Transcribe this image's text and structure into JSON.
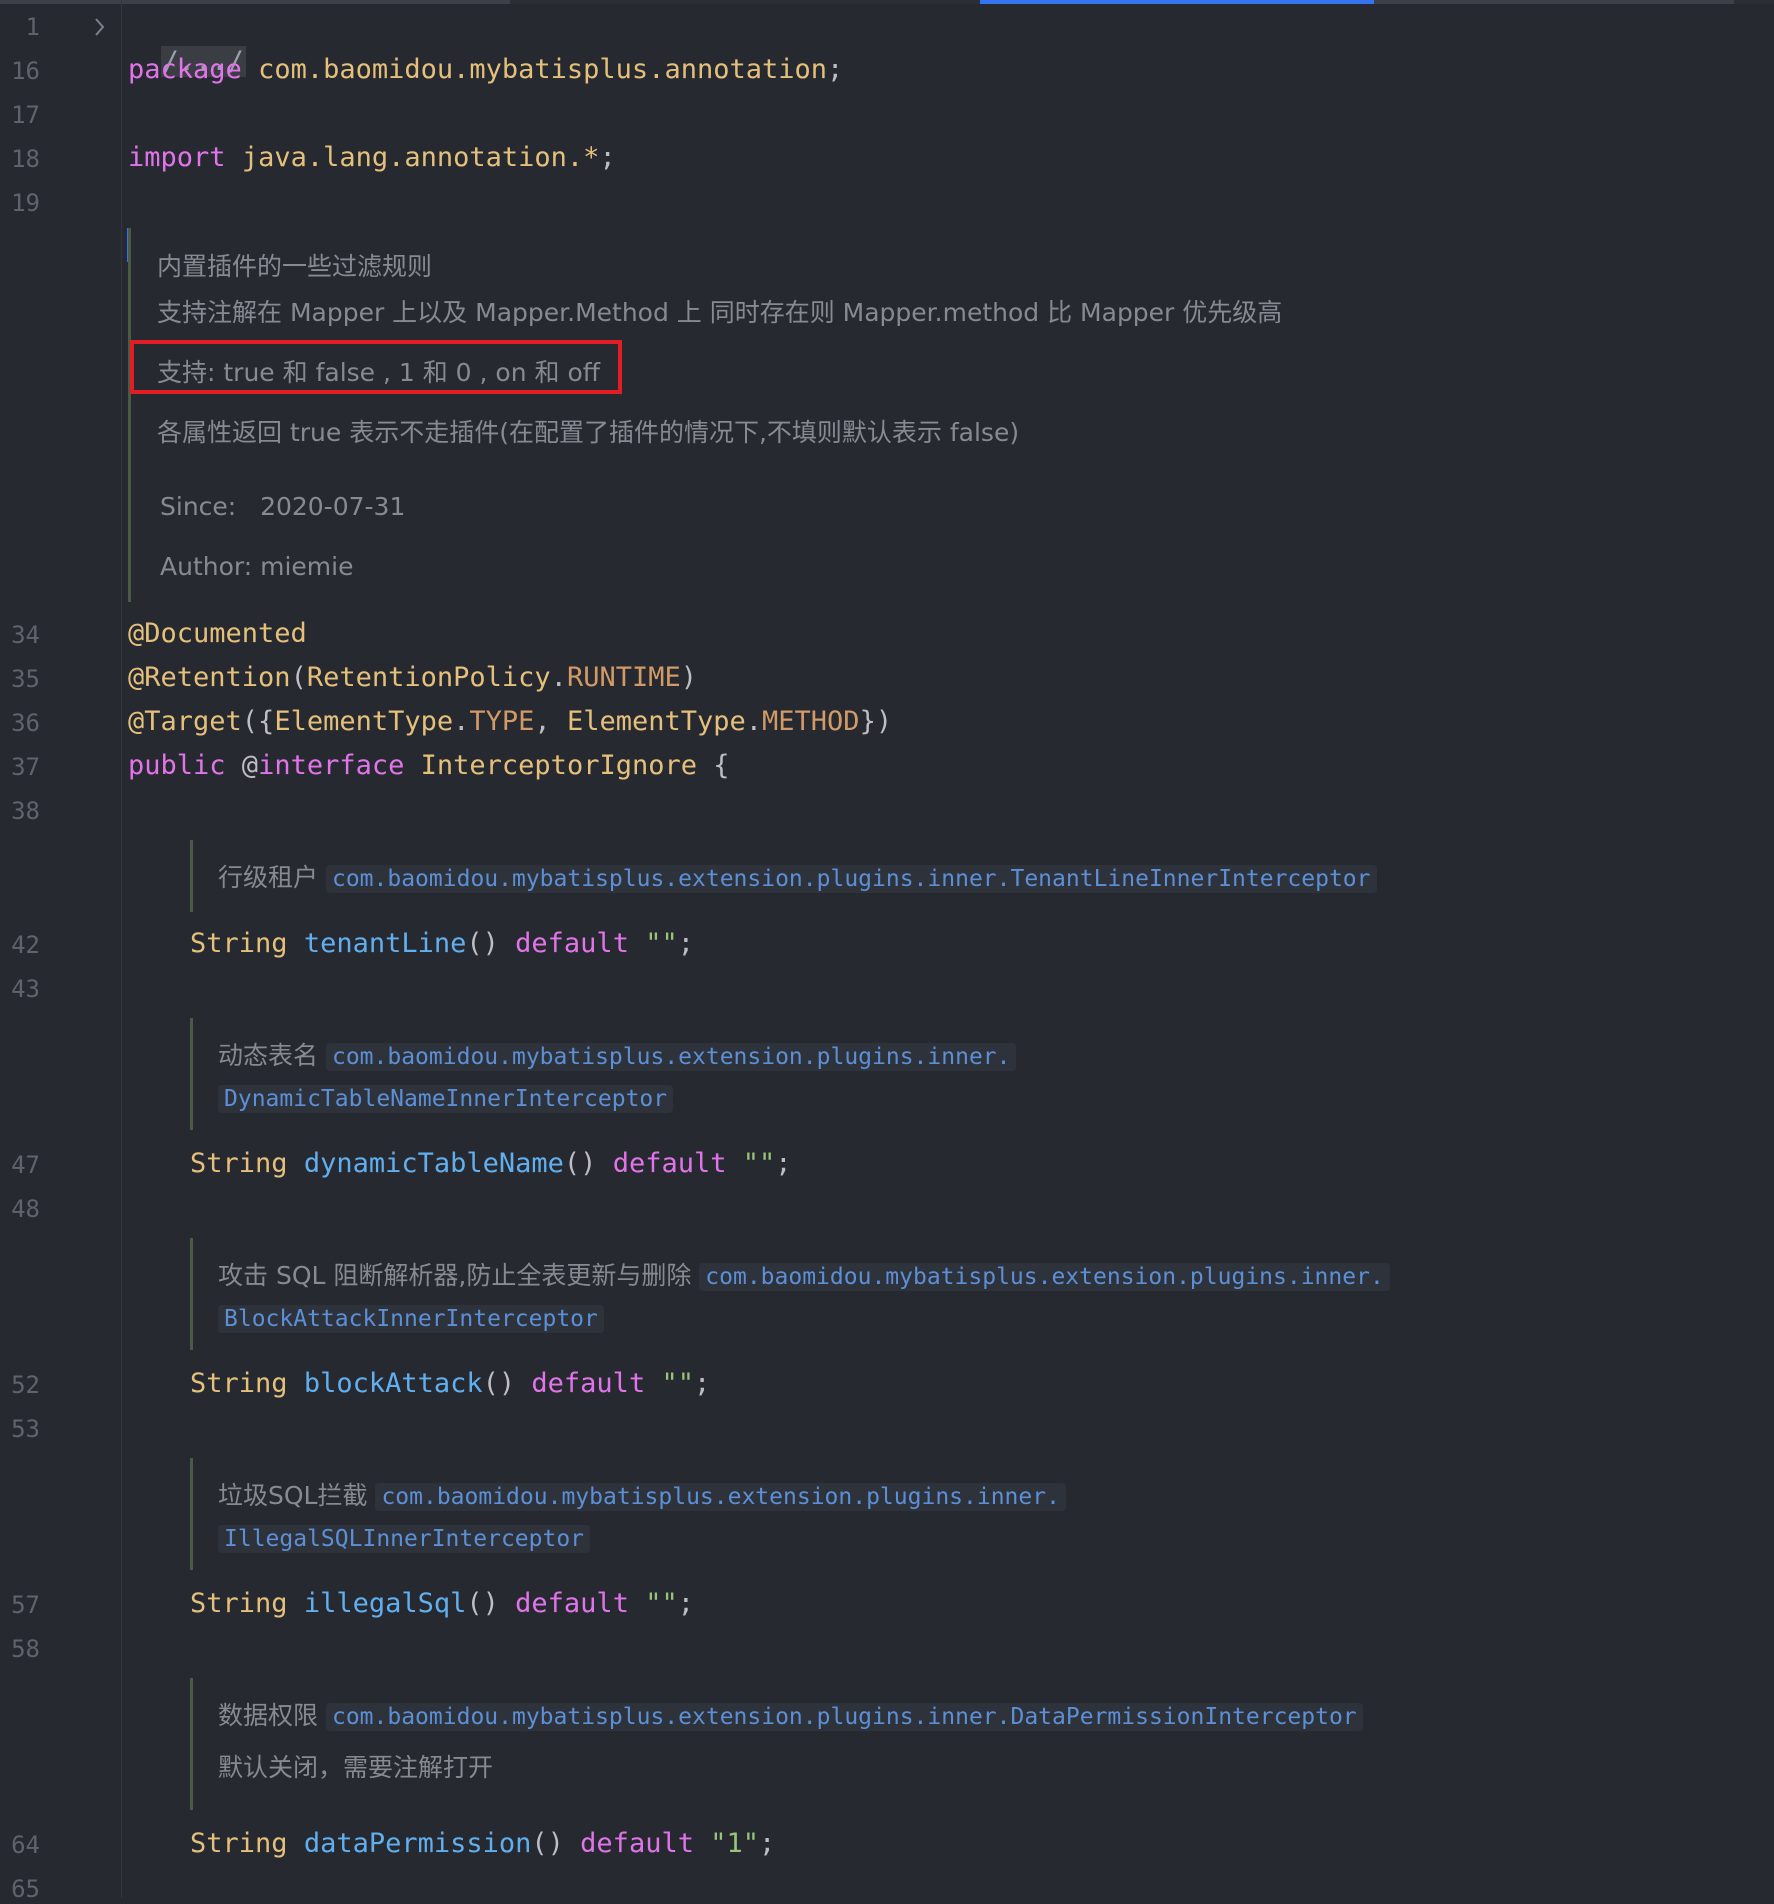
{
  "line_numbers": [
    "1",
    "16",
    "17",
    "18",
    "19",
    "34",
    "35",
    "36",
    "37",
    "38",
    "42",
    "43",
    "47",
    "48",
    "52",
    "53",
    "57",
    "58",
    "64",
    "65"
  ],
  "code": {
    "fold": "/.../",
    "package_kw": "package",
    "package_name": "com.baomidou.mybatisplus.annotation",
    "semicolon": ";",
    "import_kw": "import",
    "import_name": "java.lang.annotation.*",
    "ann_documented": "@Documented",
    "ann_retention": "@Retention",
    "retention_policy": "RetentionPolicy",
    "runtime": "RUNTIME",
    "ann_target": "@Target",
    "element_type": "ElementType",
    "type_const": "TYPE",
    "method_const": "METHOD",
    "public_kw": "public",
    "interface_kw": "@interface",
    "interface_name": "InterceptorIgnore",
    "open_brace": "{",
    "string_type": "String",
    "default_kw": "default",
    "empty_str": "\"\"",
    "one_str": "\"1\"",
    "methods": [
      "tenantLine",
      "dynamicTableName",
      "blockAttack",
      "illegalSql",
      "dataPermission"
    ]
  },
  "javadoc": {
    "line1": "内置插件的一些过滤规则",
    "line2": "支持注解在 Mapper 上以及 Mapper.Method 上 同时存在则 Mapper.method 比 Mapper 优先级高",
    "line3": "支持: true 和 false , 1 和 0 , on 和 off",
    "line4": "各属性返回 true 表示不走插件(在配置了插件的情况下,不填则默认表示 false)",
    "since_label": "Since:",
    "since_value": "2020-07-31",
    "author_label": "Author:",
    "author_value": "miemie"
  },
  "method_docs": {
    "tenant_text": "行级租户",
    "tenant_link": "com.baomidou.mybatisplus.extension.plugins.inner.TenantLineInnerInterceptor",
    "dynamic_text": "动态表名",
    "dynamic_link1": "com.baomidou.mybatisplus.extension.plugins.inner.",
    "dynamic_link2": "DynamicTableNameInnerInterceptor",
    "block_text": "攻击 SQL 阻断解析器,防止全表更新与删除",
    "block_link1": "com.baomidou.mybatisplus.extension.plugins.inner.",
    "block_link2": "BlockAttackInnerInterceptor",
    "illegal_text": "垃圾SQL拦截",
    "illegal_link1": "com.baomidou.mybatisplus.extension.plugins.inner.",
    "illegal_link2": "IllegalSQLInnerInterceptor",
    "perm_text": "数据权限",
    "perm_link": "com.baomidou.mybatisplus.extension.plugins.inner.DataPermissionInterceptor",
    "perm_text2": "默认关闭，需要注解打开"
  },
  "colors": {
    "background": "#262930",
    "keyword": "#e274ea",
    "type": "#e5c07b",
    "function": "#61afef",
    "string": "#98c379",
    "highlight_box": "#e21d24"
  }
}
